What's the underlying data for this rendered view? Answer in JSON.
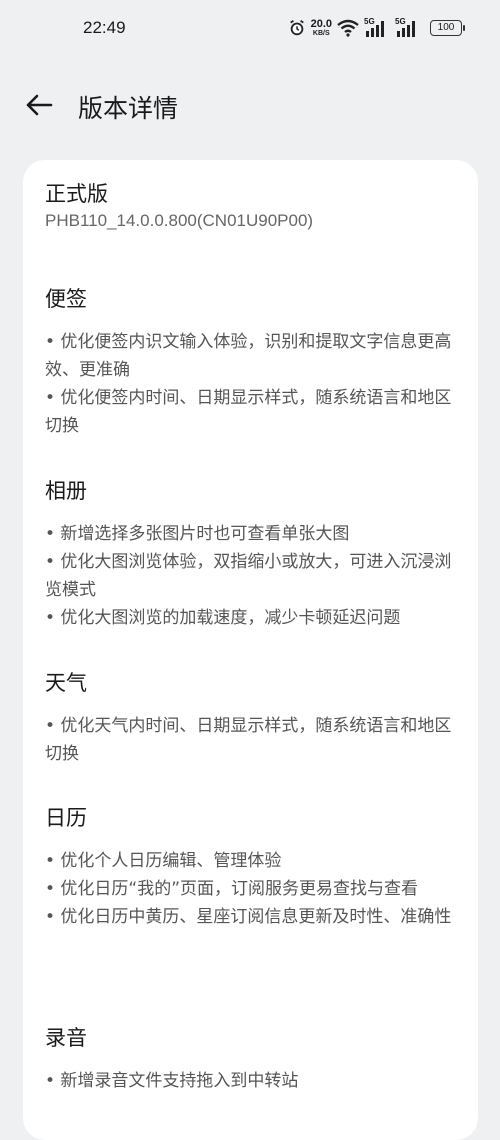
{
  "status_bar": {
    "time": "22:49",
    "net_speed_value": "20.0",
    "net_speed_unit": "KB/S",
    "sim1_label": "5G",
    "sim2_label": "5G",
    "battery": "100"
  },
  "header": {
    "title": "版本详情"
  },
  "release": {
    "name": "正式版",
    "build": "PHB110_14.0.0.800(CN01U90P00)"
  },
  "sections": [
    {
      "title": "便签",
      "items": [
        "• 优化便签内识文输入体验，识别和提取文字信息更高效、更准确",
        "• 优化便签内时间、日期显示样式，随系统语言和地区切换"
      ]
    },
    {
      "title": "相册",
      "items": [
        "• 新增选择多张图片时也可查看单张大图",
        "• 优化大图浏览体验，双指缩小或放大，可进入沉浸浏览模式",
        "• 优化大图浏览的加载速度，减少卡顿延迟问题"
      ]
    },
    {
      "title": "天气",
      "items": [
        "• 优化天气内时间、日期显示样式，随系统语言和地区切换"
      ]
    },
    {
      "title": "日历",
      "items": [
        "• 优化个人日历编辑、管理体验",
        "• 优化日历“我的”页面，订阅服务更易查找与查看",
        "• 优化日历中黄历、星座订阅信息更新及时性、准确性"
      ]
    },
    {
      "title": "录音",
      "items": [
        "• 新增录音文件支持拖入到中转站"
      ]
    }
  ],
  "icons": {
    "back": "arrow-left-icon",
    "alarm": "alarm-icon",
    "wifi": "wifi-icon",
    "signal": "signal-icon"
  },
  "colors": {
    "background": "#eef0f2",
    "card": "#ffffff",
    "body_text": "#555555"
  }
}
